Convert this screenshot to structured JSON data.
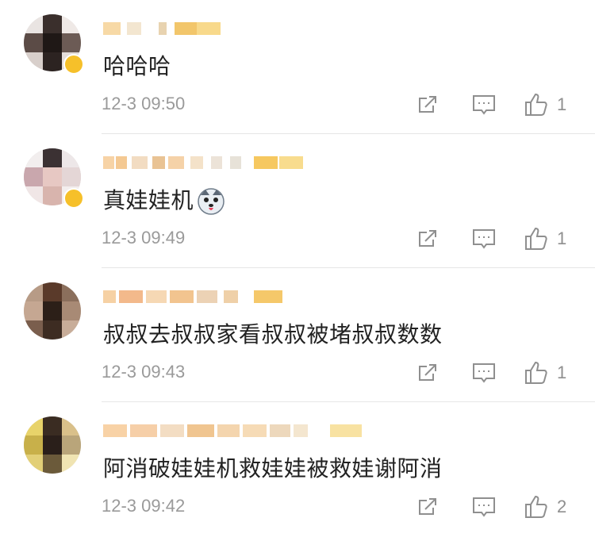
{
  "comments": [
    {
      "text": "哈哈哈",
      "time": "12-3 09:50",
      "likes": "1"
    },
    {
      "text": "真娃娃机",
      "time": "12-3 09:49",
      "likes": "1",
      "emoji": "husky-dog-emoji"
    },
    {
      "text": "叔叔去叔叔家看叔叔被堵叔叔数数",
      "time": "12-3 09:43",
      "likes": "1"
    },
    {
      "text": "阿消破娃娃机救娃娃被救娃谢阿消",
      "time": "12-3 09:42",
      "likes": "2"
    }
  ],
  "colors": {
    "text": "#222222",
    "meta": "#9a9a9a",
    "icon": "#8f8f8f",
    "badge": "#f6c02a"
  }
}
